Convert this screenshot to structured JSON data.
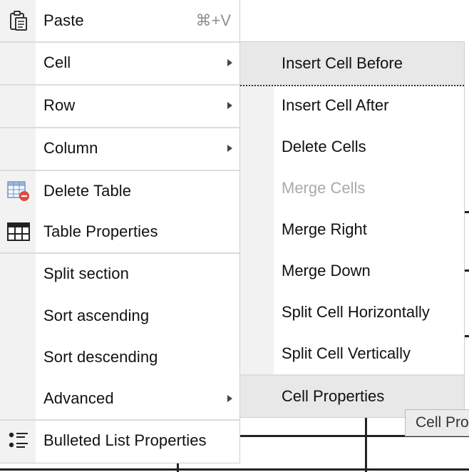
{
  "context_menu": {
    "items": [
      {
        "label": "Paste",
        "shortcut": "⌘+V",
        "icon": "paste-icon"
      },
      {
        "label": "Cell",
        "has_submenu": true
      },
      {
        "label": "Row",
        "has_submenu": true
      },
      {
        "label": "Column",
        "has_submenu": true
      },
      {
        "label": "Delete Table",
        "icon": "delete-table-icon"
      },
      {
        "label": "Table Properties",
        "icon": "table-properties-icon"
      },
      {
        "label": "Split section"
      },
      {
        "label": "Sort ascending"
      },
      {
        "label": "Sort descending"
      },
      {
        "label": "Advanced",
        "has_submenu": true
      },
      {
        "label": "Bulleted List Properties",
        "icon": "bulleted-list-icon"
      }
    ]
  },
  "cell_submenu": {
    "items": [
      {
        "label": "Insert Cell Before",
        "state": "hover"
      },
      {
        "label": "Insert Cell After"
      },
      {
        "label": "Delete Cells"
      },
      {
        "label": "Merge Cells",
        "state": "disabled"
      },
      {
        "label": "Merge Right"
      },
      {
        "label": "Merge Down"
      },
      {
        "label": "Split Cell Horizontally"
      },
      {
        "label": "Split Cell Vertically"
      },
      {
        "label": "Cell Properties",
        "state": "hover"
      }
    ]
  },
  "tooltip": {
    "text": "Cell Properties"
  },
  "colors": {
    "accent_delete": "#e0483e",
    "table_icon_blue": "#6f93c9",
    "hover_bg": "#e8e8e8",
    "gutter_bg": "#f2f2f2"
  }
}
